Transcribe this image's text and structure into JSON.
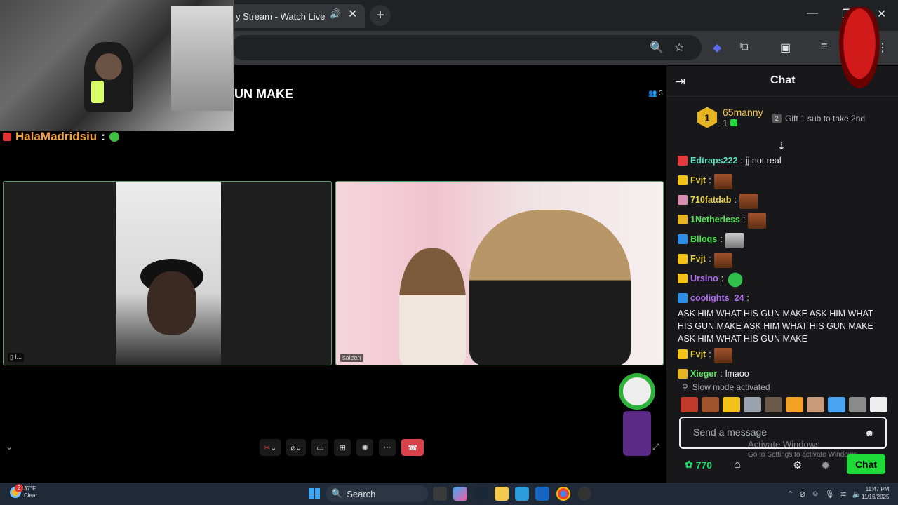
{
  "browser": {
    "tab_title": "y Stream - Watch Live",
    "new_tab_label": "+"
  },
  "stream": {
    "title": "UN MAKE",
    "viewer_count": "3",
    "overlay_username": "HalaMadridsiu",
    "overlay_suffix": ":",
    "left_tile_label": "l...",
    "right_tile_label": "saleen"
  },
  "chat": {
    "title": "Chat",
    "leaderboard": {
      "rank": "1",
      "username": "65manny",
      "count": "1"
    },
    "gift_sub_label": "Gift 1 sub to take 2nd",
    "messages": [
      {
        "user": "Edtraps222",
        "color": "#5ce1c1",
        "badge_color": "#e23b3b",
        "text": "jj not real",
        "emote": ""
      },
      {
        "user": "Fvjt",
        "color": "#e6d24a",
        "badge_color": "#f2c218",
        "text": "",
        "emote": "brown"
      },
      {
        "user": "710fatdab",
        "color": "#e6d24a",
        "badge_color": "#d88db0",
        "text": "",
        "emote": "brown"
      },
      {
        "user": "1Netherless",
        "color": "#5ce15c",
        "badge_color": "#e6b422",
        "text": "",
        "emote": "brown"
      },
      {
        "user": "Blloqs",
        "color": "#4ae84a",
        "badge_color": "#2e8de6",
        "text": "",
        "emote": "grey"
      },
      {
        "user": "Fvjt",
        "color": "#e6d24a",
        "badge_color": "#f2c218",
        "text": "",
        "emote": "brown"
      },
      {
        "user": "Ursino",
        "color": "#b06ef2",
        "badge_color": "#f2c218",
        "text": "",
        "emote": "green"
      },
      {
        "user": "coolights_24",
        "color": "#b06ef2",
        "badge_color": "#2e8de6",
        "text": "ASK HIM WHAT HIS GUN MAKE ASK HIM WHAT HIS GUN MAKE ASK HIM WHAT HIS GUN MAKE ASK HIM WHAT HIS GUN MAKE",
        "emote": ""
      },
      {
        "user": "Fvjt",
        "color": "#e6d24a",
        "badge_color": "#f2c218",
        "text": "",
        "emote": "brown"
      },
      {
        "user": "Xieger",
        "color": "#5ce15c",
        "badge_color": "#e6b422",
        "text": "lmaoo",
        "emote": ""
      }
    ],
    "slow_mode_label": "Slow mode activated",
    "input_placeholder": "Send a message",
    "points": "770",
    "chat_button_label": "Chat",
    "watermark_line1": "Activate Windows",
    "watermark_line2": "Go to Settings to activate Windows."
  },
  "taskbar": {
    "weather_temp": "37°F",
    "weather_desc": "Clear",
    "weather_alert": "2",
    "search_label": "Search",
    "time": "11:47 PM",
    "date": "11/16/2025"
  },
  "colors": {
    "chat_bg": "#18181b",
    "accent_green": "#1fdb3a",
    "points_green": "#1fdb6a",
    "hangup_red": "#d9424b"
  }
}
